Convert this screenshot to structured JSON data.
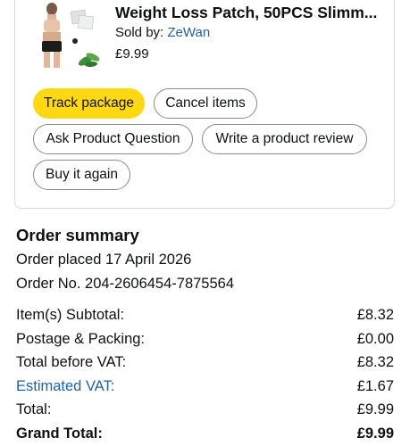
{
  "product": {
    "title": "Weight Loss Patch, 50PCS Slimm...",
    "sold_by_label": "Sold by:",
    "seller": "ZeWan",
    "price": "£9.99",
    "image_icon": "product-thumbnail-icon"
  },
  "actions": {
    "track": "Track package",
    "cancel": "Cancel items",
    "ask": "Ask Product Question",
    "review": "Write a product review",
    "buy_again": "Buy it again"
  },
  "summary": {
    "title": "Order summary",
    "order_placed": "Order placed 17 April 2026",
    "order_no": "Order No. 204-2606454-7875564",
    "rows": [
      {
        "label": "Item(s) Subtotal:",
        "value": "£8.32"
      },
      {
        "label": "Postage & Packing:",
        "value": "£0.00"
      },
      {
        "label": "Total before VAT:",
        "value": "£8.32"
      },
      {
        "label": "Estimated VAT:",
        "value": "£1.67"
      },
      {
        "label": "Total:",
        "value": "£9.99"
      },
      {
        "label": "Grand Total:",
        "value": "£9.99"
      }
    ]
  },
  "colors": {
    "primary_button": "#ffd814",
    "link": "#2162a1",
    "border": "#d5d9d9"
  }
}
